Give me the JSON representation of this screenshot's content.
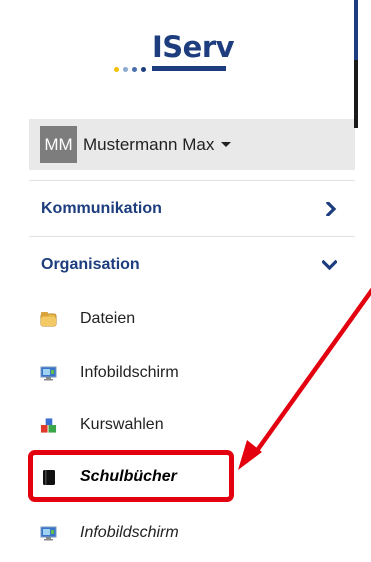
{
  "logo": {
    "text": "IServ",
    "dot_colors": [
      "#f2c100",
      "#8da9d0",
      "#4a6fad",
      "#1d3d7e"
    ],
    "brand_color": "#1d3d7e"
  },
  "user": {
    "initials": "MM",
    "name": "Mustermann Max"
  },
  "sections": [
    {
      "label": "Kommunikation",
      "icon": "chevron-right-icon"
    },
    {
      "label": "Organisation",
      "icon": "chevron-down-icon"
    }
  ],
  "items": [
    {
      "label": "Dateien",
      "icon": "folder-icon"
    },
    {
      "label": "Infobildschirm",
      "icon": "monitor-icon"
    },
    {
      "label": "Kurswahlen",
      "icon": "course-blocks-icon"
    },
    {
      "label": "Schulbücher",
      "icon": "book-icon"
    },
    {
      "label": "Infobildschirm",
      "icon": "monitor-icon"
    }
  ],
  "annotation": {
    "color": "#e3000f",
    "target": "Schulbücher"
  }
}
